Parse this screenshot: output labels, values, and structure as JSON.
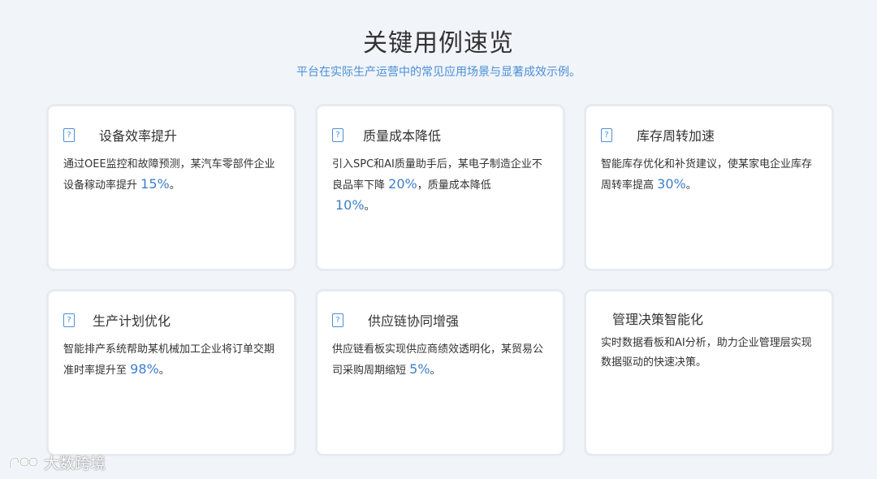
{
  "header": {
    "title": "关键用例速览",
    "subtitle": "平台在实际生产运营中的常见应用场景与显著成效示例。"
  },
  "cards": [
    {
      "icon": "document-icon",
      "title": "设备效率提升",
      "text": "通过OEE监控和故障预测，某汽车零部件企业设备稼动率提升 ",
      "highlight": "15%",
      "tail": "。"
    },
    {
      "icon": "document-icon",
      "title": "质量成本降低",
      "text": "引入SPC和AI质量助手后，某电子制造企业不良品率下降 ",
      "highlight": "20%",
      "mid": "，质量成本降低",
      "highlight2": "10%",
      "tail": "。"
    },
    {
      "icon": "document-icon",
      "title": "库存周转加速",
      "text": "智能库存优化和补货建议，使某家电企业库存周转率提高 ",
      "highlight": "30%",
      "tail": "。"
    },
    {
      "icon": "document-icon",
      "title": "生产计划优化",
      "text": "智能排产系统帮助某机械加工企业将订单交期准时率提升至 ",
      "highlight": "98%",
      "tail": "。"
    },
    {
      "icon": "document-icon",
      "title": "供应链协同增强",
      "text": "供应链看板实现供应商绩效透明化，某贸易公司采购周期缩短 ",
      "highlight": "5%",
      "tail": "。"
    },
    {
      "title": "管理决策智能化",
      "text": "实时数据看板和AI分析，助力企业管理层实现数据驱动的快速决策。"
    }
  ],
  "watermark": {
    "text": "大数跨境"
  },
  "colors": {
    "accent": "#4a8fd8",
    "highlight": "#3d7fc9",
    "background": "#f1f4f9",
    "card": "#ffffff"
  }
}
